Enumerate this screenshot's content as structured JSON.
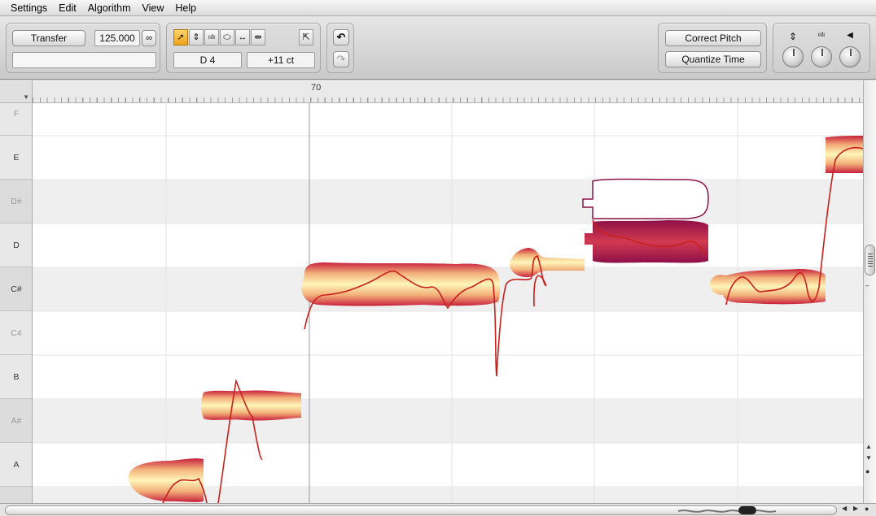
{
  "menu": [
    "Settings",
    "Edit",
    "Algorithm",
    "View",
    "Help"
  ],
  "toolbar": {
    "transfer_label": "Transfer",
    "tempo": "125.000",
    "pitch_readout": "D 4",
    "cents_readout": "+11 ct",
    "correct_pitch_label": "Correct Pitch",
    "quantize_time_label": "Quantize Time",
    "tools": [
      {
        "name": "main-tool",
        "glyph": "➚"
      },
      {
        "name": "pitch-tool",
        "glyph": "⇕"
      },
      {
        "name": "formant-tool",
        "glyph": "ıılı"
      },
      {
        "name": "amplitude-tool",
        "glyph": "⬭"
      },
      {
        "name": "time-tool",
        "glyph": "↔"
      },
      {
        "name": "note-separation-tool",
        "glyph": "⇹"
      }
    ],
    "scroll_tool_glyph": "⇱",
    "undo_glyph": "↶",
    "redo_glyph": "↷",
    "knob_icons": [
      "⇕",
      "ıılı",
      "◀"
    ]
  },
  "ruler": {
    "bar_label": "70"
  },
  "keys": [
    {
      "label": "F",
      "dim": true,
      "sharp": false
    },
    {
      "label": "E",
      "dim": false,
      "sharp": false
    },
    {
      "label": "D#",
      "dim": true,
      "sharp": true
    },
    {
      "label": "D",
      "dim": false,
      "sharp": false
    },
    {
      "label": "C#",
      "dim": false,
      "sharp": true
    },
    {
      "label": "C4",
      "dim": true,
      "sharp": false
    },
    {
      "label": "B",
      "dim": false,
      "sharp": false
    },
    {
      "label": "A#",
      "dim": true,
      "sharp": true
    },
    {
      "label": "A",
      "dim": false,
      "sharp": false
    },
    {
      "label": "",
      "dim": true,
      "sharp": true
    }
  ],
  "colors": {
    "blob_light": "#fff6b8",
    "blob_dark": "#c8203c",
    "blob_selected": "#8e1048",
    "pitch_curve": "#c8201c",
    "sharp_row": "#efefef"
  }
}
